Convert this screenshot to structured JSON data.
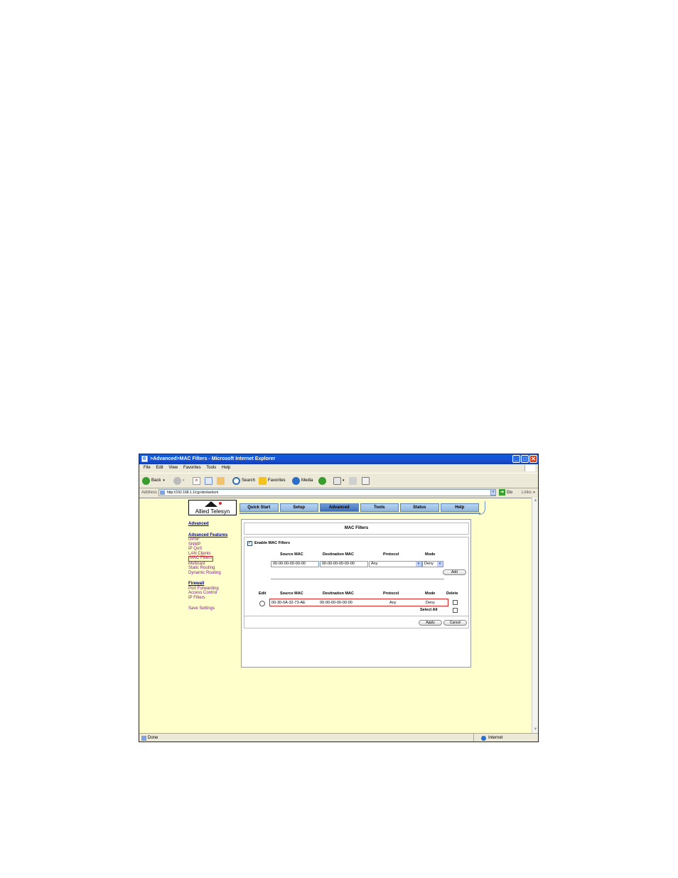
{
  "window": {
    "title": ">Advanced>MAC Filters - Microsoft Internet Explorer",
    "controls": {
      "minimize": "_",
      "maximize": "□",
      "close": "✕"
    }
  },
  "menu": [
    "File",
    "Edit",
    "View",
    "Favorites",
    "Tools",
    "Help"
  ],
  "toolbar": {
    "back": "Back",
    "search": "Search",
    "favorites": "Favorites",
    "media": "Media"
  },
  "address": {
    "label": "Address",
    "url": "http://192.168.1.1/cgi-bin/webcm",
    "go": "Go",
    "links": "Links",
    "links_more": "»"
  },
  "brand": {
    "name": "Allied Telesyn"
  },
  "nav_tabs": [
    "Quick Start",
    "Setup",
    "Advanced",
    "Tools",
    "Status",
    "Help"
  ],
  "active_tab": "Advanced",
  "sidebar": {
    "title": "Advanced",
    "features_heading": "Advanced Features",
    "features": [
      "UPnP",
      "SNMP",
      "IP QoS",
      "LAN Clients",
      "MAC Filters",
      "Multicast",
      "Static Routing",
      "Dynamic Routing"
    ],
    "selected": "MAC Filters",
    "firewall_heading": "Firewall",
    "firewall": [
      "Port Forwarding",
      "Access Control",
      "IP Filters"
    ],
    "save": "Save Settings"
  },
  "panel": {
    "title": "MAC Filters",
    "enable_label": "Enable MAC Filters",
    "enable_checked": "✓",
    "form": {
      "headers": {
        "source": "Source MAC",
        "destination": "Destination MAC",
        "protocol": "Protocol",
        "mode": "Mode"
      },
      "source_value": "00-00-00-00-00-00",
      "destination_value": "00-00-00-00-00-00",
      "protocol_value": "Any",
      "mode_value": "Deny",
      "add_button": "Add"
    },
    "table": {
      "headers": {
        "edit": "Edit",
        "source": "Source MAC",
        "destination": "Destination MAC",
        "protocol": "Protocol",
        "mode": "Mode",
        "delete": "Delete"
      },
      "rows": [
        {
          "source": "00-30-0A-32-73-AE",
          "destination": "00-00-00-00-00-00",
          "protocol": "Any",
          "mode": "Deny"
        }
      ],
      "select_all": "Select All"
    },
    "apply_button": "Apply",
    "cancel_button": "Cancel"
  },
  "status": {
    "left": "Done",
    "zone": "Internet"
  }
}
